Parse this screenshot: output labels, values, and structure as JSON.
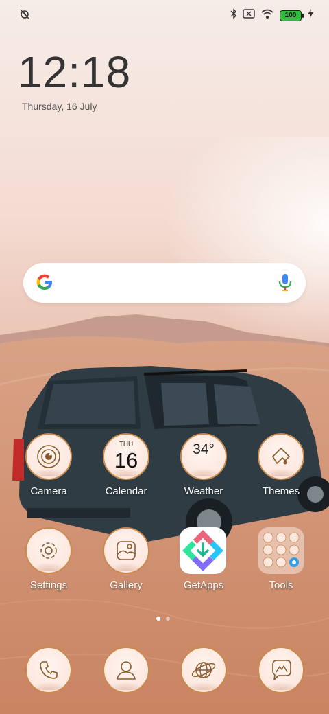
{
  "status_bar": {
    "left_icons": [
      "alarm-off-icon"
    ],
    "right_icons": [
      "bluetooth-icon",
      "no-sim-icon",
      "wifi-icon"
    ],
    "battery": "100",
    "charging_icon": "bolt-icon"
  },
  "clock": {
    "time": "12:18",
    "date": "Thursday, 16 July"
  },
  "search": {
    "left_icon": "google-logo-icon",
    "right_icon": "mic-icon"
  },
  "apps_row1": [
    {
      "label": "Camera",
      "icon": "camera-icon"
    },
    {
      "label": "Calendar",
      "icon": "calendar-icon",
      "day": "THU",
      "date": "16"
    },
    {
      "label": "Weather",
      "icon": "weather-icon",
      "temp": "34°"
    },
    {
      "label": "Themes",
      "icon": "themes-icon"
    }
  ],
  "apps_row2": [
    {
      "label": "Settings",
      "icon": "gear-icon"
    },
    {
      "label": "Gallery",
      "icon": "gallery-icon"
    },
    {
      "label": "GetApps",
      "icon": "getapps-icon"
    },
    {
      "label": "Tools",
      "icon": "folder-icon"
    }
  ],
  "dock": [
    {
      "icon": "phone-icon"
    },
    {
      "icon": "contacts-icon"
    },
    {
      "icon": "browser-icon"
    },
    {
      "icon": "messages-icon"
    }
  ],
  "page_indicator": {
    "pages": 2,
    "current": 1
  },
  "colors": {
    "icon_border": "#c98a4d",
    "icon_line": "#8a5a2a",
    "label_text": "#ffffff"
  }
}
